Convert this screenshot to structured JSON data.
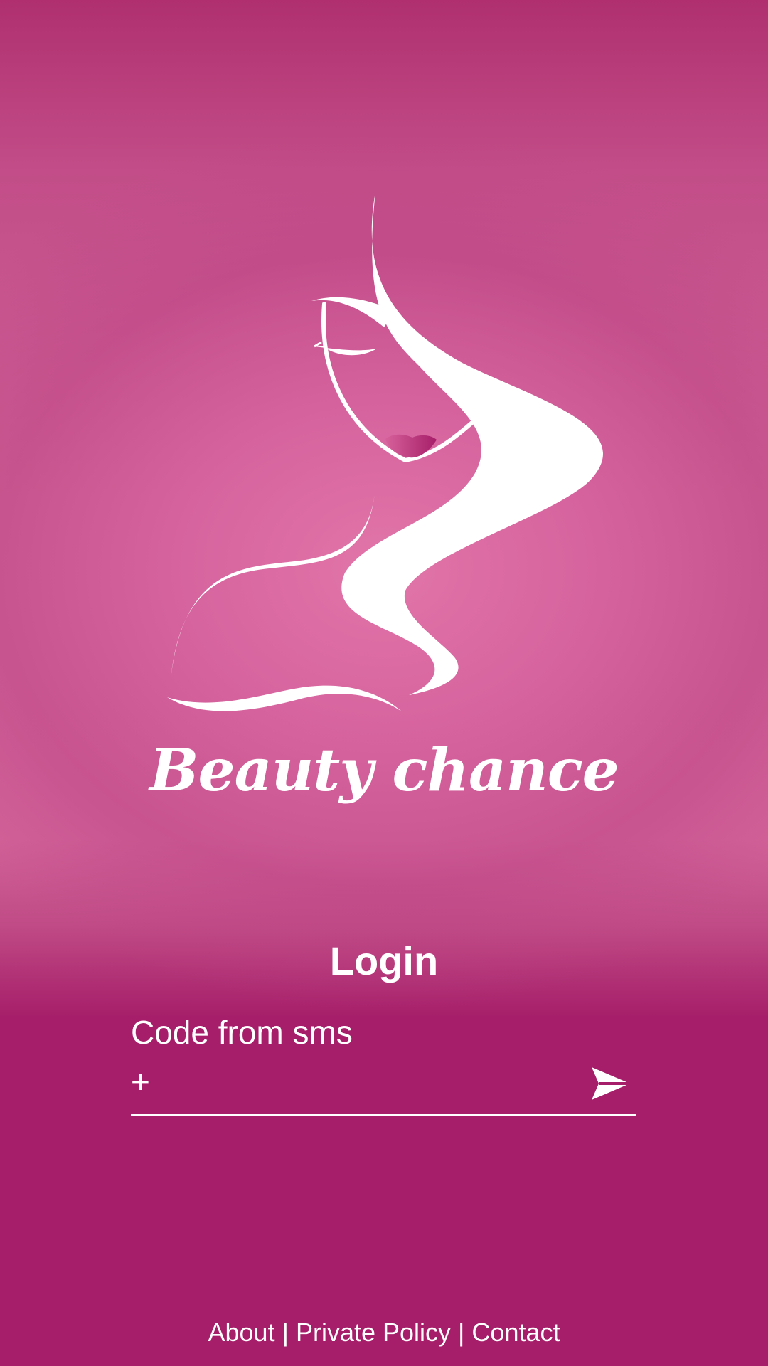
{
  "app": {
    "brand_name": "Beauty chance"
  },
  "login": {
    "title": "Login",
    "code_label": "Code from sms",
    "prefix": "+",
    "code_value": "",
    "send_icon": "send-arrow-icon"
  },
  "footer": {
    "about": "About",
    "separator_1": "|",
    "privacy": "Private Policy",
    "separator_2": "|",
    "contact": "Contact"
  },
  "colors": {
    "primary": "#a61e69",
    "gradient_light": "#d8699d",
    "text": "#ffffff"
  }
}
